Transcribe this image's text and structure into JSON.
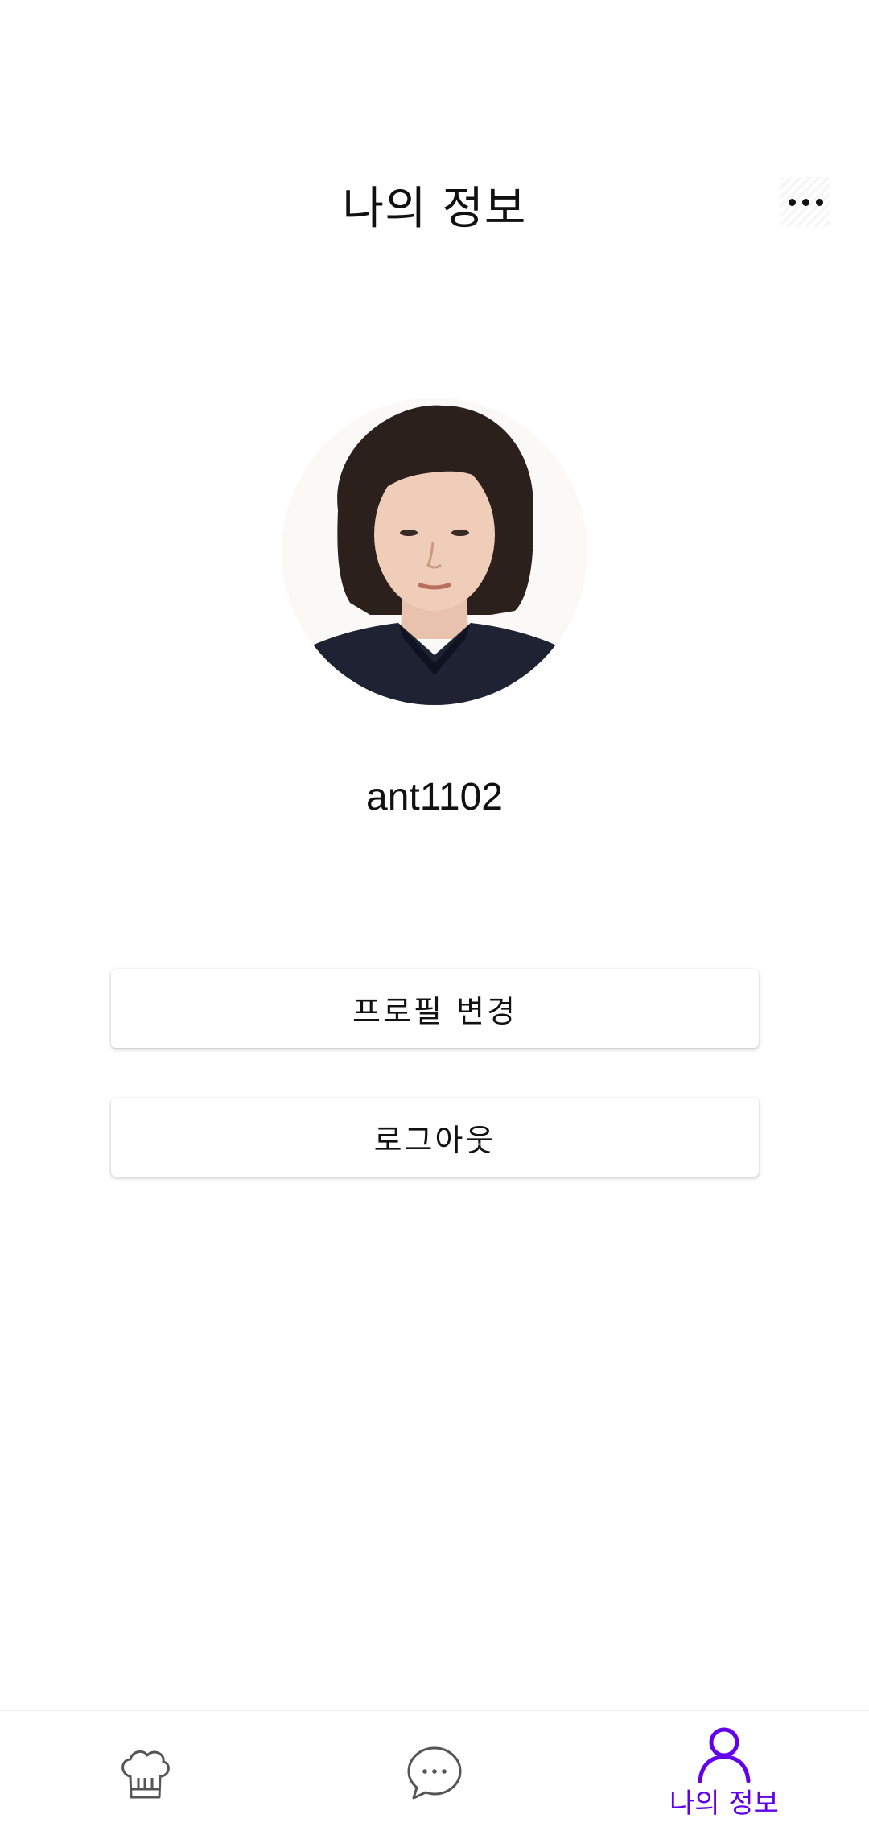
{
  "header": {
    "title": "나의 정보",
    "more_icon": "more-horizontal-icon"
  },
  "profile": {
    "username": "ant1102",
    "avatar_icon": "user-photo"
  },
  "actions": {
    "edit_profile_label": "프로필 변경",
    "logout_label": "로그아웃"
  },
  "bottom_nav": {
    "active_color": "#6200ee",
    "inactive_color": "#555555",
    "items": [
      {
        "icon": "chef-hat-icon",
        "label": ""
      },
      {
        "icon": "chat-bubble-icon",
        "label": ""
      },
      {
        "icon": "person-icon",
        "label": "나의 정보"
      }
    ]
  }
}
